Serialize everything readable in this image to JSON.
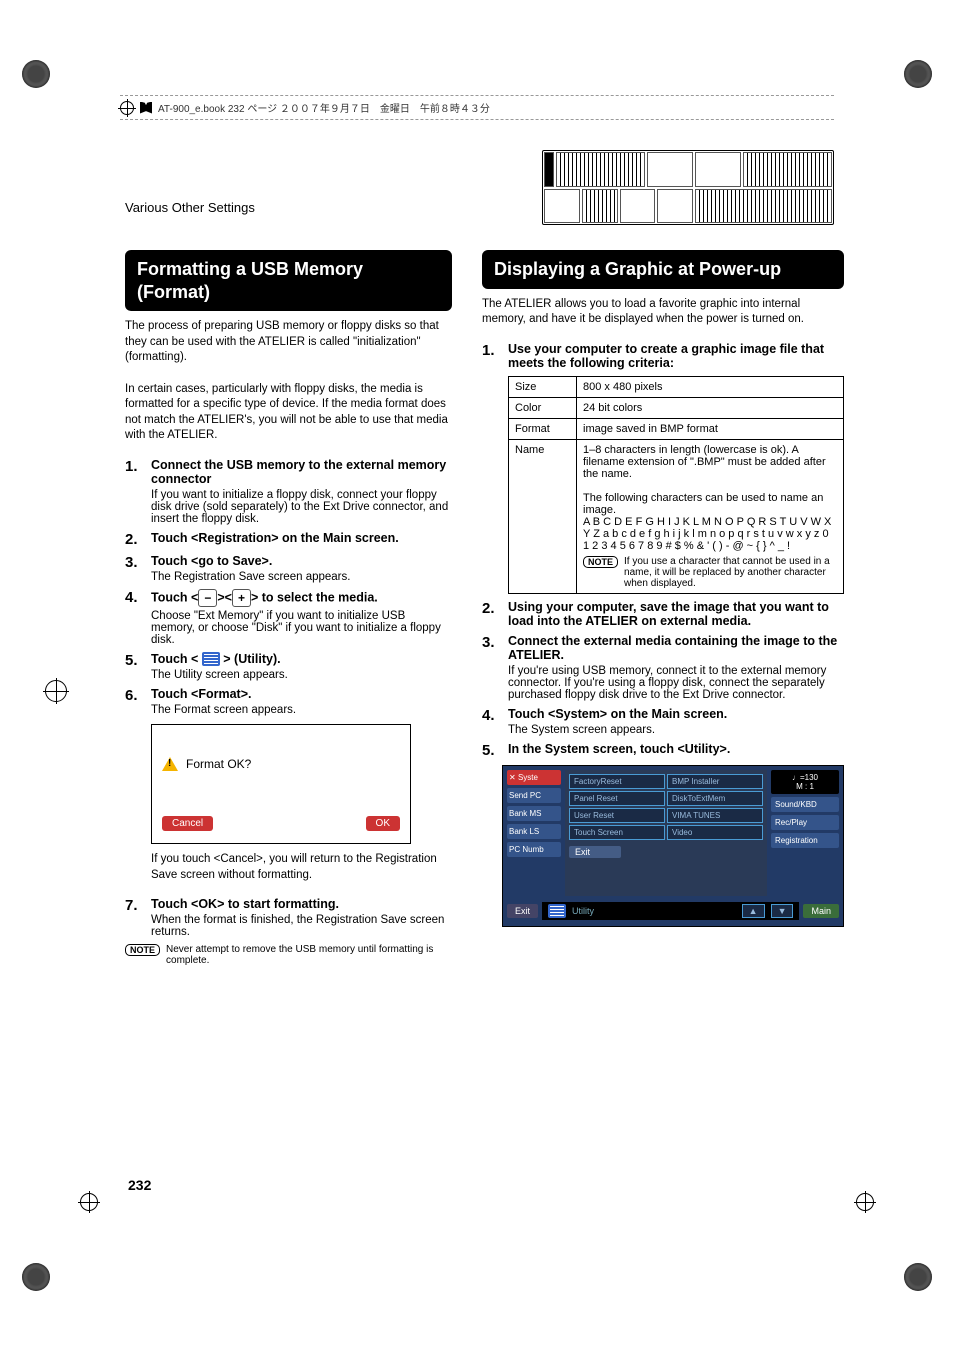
{
  "header": {
    "filename_line": "AT-900_e.book  232 ページ  ２００７年９月７日　金曜日　午前８時４３分",
    "section": "Various Other Settings"
  },
  "page_number": "232",
  "left": {
    "heading": "Formatting a USB Memory (Format)",
    "intro1": "The process of preparing USB memory or floppy disks so that they can be used with the ATELIER is called \"initialization\" (formatting).",
    "intro2": "In certain cases, particularly with floppy disks, the media is formatted for a specific type of device. If the media format does not match the ATELIER's, you will not be able to use that media with the ATELIER.",
    "steps": {
      "1": {
        "title": "Connect the USB memory to the external memory connector",
        "body": "If you want to initialize a floppy disk, connect your floppy disk drive (sold separately) to the Ext Drive connector, and insert the floppy disk."
      },
      "2": {
        "title": "Touch <Registration> on the Main screen."
      },
      "3": {
        "title": "Touch <go to Save>.",
        "body": "The Registration Save screen appears."
      },
      "4": {
        "title_pre": "Touch <",
        "minus": "−",
        "mid": "><",
        "plus": "+",
        "title_post": "> to select the media.",
        "body": "Choose \"Ext Memory\" if you want to initialize USB memory, or choose \"Disk\" if you want to initialize a floppy disk."
      },
      "5": {
        "title_pre": "Touch < ",
        "title_post": " > (Utility).",
        "body": "The Utility screen appears."
      },
      "6": {
        "title": "Touch <Format>.",
        "body": "The Format screen appears."
      },
      "dialog": {
        "msg": "Format OK?",
        "cancel": "Cancel",
        "ok": "OK"
      },
      "after_dialog": "If you touch <Cancel>, you will return to the Registration Save screen without formatting.",
      "7": {
        "title": "Touch <OK> to start formatting.",
        "body": "When the format is finished, the Registration Save screen returns."
      }
    },
    "note": {
      "label": "NOTE",
      "text": "Never attempt to remove the USB memory until formatting is complete."
    }
  },
  "right": {
    "heading": "Displaying a Graphic at Power-up",
    "intro": "The ATELIER allows you to load a favorite graphic into internal memory, and have it be displayed when the power is turned on.",
    "steps": {
      "1": {
        "title": "Use your computer to create a graphic image file that meets the following criteria:"
      },
      "table": {
        "size_label": "Size",
        "size_val": "800 x 480 pixels",
        "color_label": "Color",
        "color_val": "24 bit colors",
        "format_label": "Format",
        "format_val": "image saved in BMP format",
        "name_label": "Name",
        "name_val_1": "1–8 characters in length (lowercase is ok). A filename extension of \".BMP\" must be added after the name.",
        "name_val_2": "The following characters can be used to name an image.",
        "name_val_3": "A B C D E F G H I J K L M N O P Q R S T U V W X Y Z a b c d e f g h i j k l m n o p q r s t u v w x y z 0 1 2 3 4 5 6 7 8 9 # $ % & ' ( ) - @ ~ { } ^ _ !",
        "name_note_label": "NOTE",
        "name_note_text": "If you use a character that cannot be used in a name, it will be replaced by another character when displayed."
      },
      "2": {
        "title": "Using your computer, save the image that you want to load into the ATELIER on external media."
      },
      "3": {
        "title": "Connect the external media containing the image to the ATELIER.",
        "body": "If you're using USB memory, connect it to the external memory connector. If you're using a floppy disk, connect the separately purchased floppy disk drive to the Ext Drive connector."
      },
      "4": {
        "title": "Touch <System> on the Main screen.",
        "body": "The System screen appears."
      },
      "5": {
        "title": "In the System screen, touch <Utility>."
      }
    },
    "screenshot": {
      "tempo": "♩=130",
      "measure": "M :    1",
      "close": "✕",
      "system": "Syste",
      "send_pc": "Send PC",
      "bank_msb": "Bank MS",
      "bank_lsb": "Bank LS",
      "pc_num": "PC Numb",
      "factory": "FactoryReset",
      "bmp": "BMP Installer",
      "panel": "Panel Reset",
      "disk": "DiskToExtMem",
      "user": "User Reset",
      "vima": "VIMA TUNES",
      "touch": "Touch Screen",
      "video": "Video",
      "exit_small": "Exit",
      "sound": "Sound/KBD",
      "rec": "Rec/Play",
      "registration": "Registration",
      "exit": "Exit",
      "utility": "Utility",
      "up": "▲",
      "down": "▼",
      "main": "Main"
    }
  }
}
